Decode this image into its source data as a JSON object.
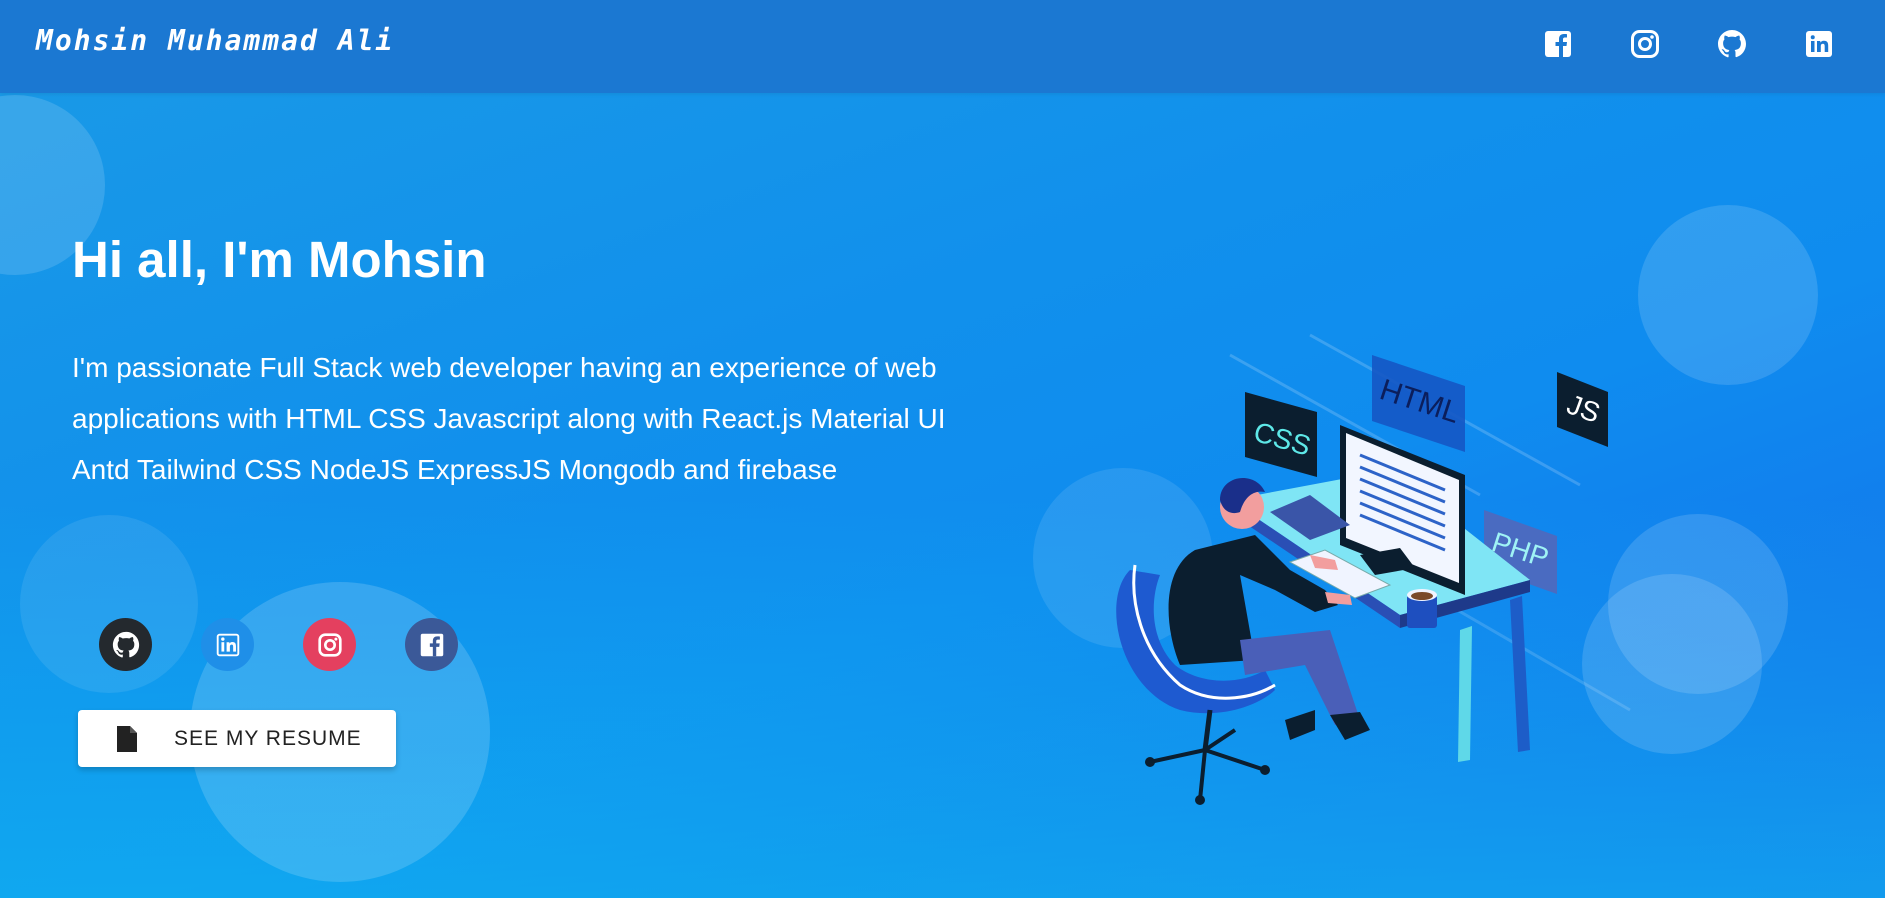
{
  "header": {
    "brand": "Mohsin Muhammad Ali",
    "icons": [
      "facebook-icon",
      "instagram-icon",
      "github-icon",
      "linkedin-icon"
    ]
  },
  "hero": {
    "greeting": "Hi all, I'm Mohsin",
    "description": "I'm passionate Full Stack web developer having an experience of web applications with HTML CSS Javascript along with React.js Material UI Antd Tailwind CSS NodeJS ExpressJS Mongodb and firebase",
    "social_icons": [
      "github-icon",
      "linkedin-icon",
      "instagram-icon",
      "facebook-icon"
    ],
    "resume_button": "SEE MY RESUME"
  },
  "illustration": {
    "tags": [
      "CSS",
      "HTML",
      "JS",
      "PHP"
    ]
  },
  "colors": {
    "header": "#1b78d2",
    "github": "#24292e",
    "linkedin": "#0e76a8",
    "instagram": "#e4405f",
    "facebook": "#3b5998"
  }
}
